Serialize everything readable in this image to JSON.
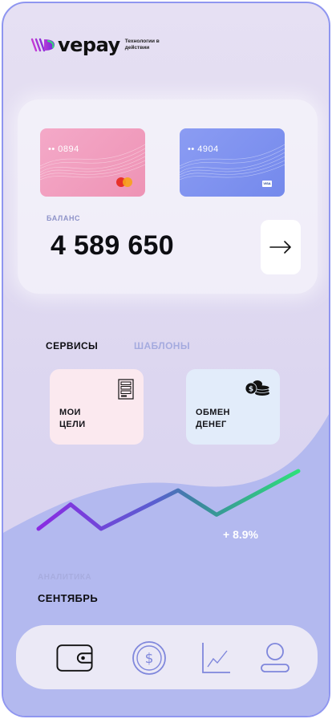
{
  "brand": {
    "name": "vepay",
    "tagline": "Технологии в действии"
  },
  "cards": [
    {
      "masked_number": "•• 0894",
      "network": "mastercard",
      "color": "#f0a0c0"
    },
    {
      "masked_number": "•• 4904",
      "network": "visa",
      "color": "#7f93ef",
      "network_label": "VISA"
    }
  ],
  "balance": {
    "label": "БАЛАНС",
    "value": "4 589 650",
    "go_icon": "arrow-right-icon"
  },
  "tabs": [
    {
      "label": "СЕРВИСЫ",
      "active": true
    },
    {
      "label": "ШАБЛОНЫ",
      "active": false
    }
  ],
  "services": [
    {
      "line1": "МОИ",
      "line2": "ЦЕЛИ",
      "icon": "goals-list-icon",
      "bg": "#fbe9ef"
    },
    {
      "line1": "ОБМЕН",
      "line2": "ДЕНЕГ",
      "icon": "coins-icon",
      "bg": "#e2ecfa"
    }
  ],
  "analytics": {
    "label": "АНАЛИТИКА",
    "month": "СЕНТЯБРЬ",
    "change": "+ 8.9%",
    "trend_points": [
      0,
      0.38,
      0,
      0.6,
      0.22,
      0.9
    ]
  },
  "nav": [
    {
      "icon": "wallet-icon",
      "active": true
    },
    {
      "icon": "dollar-coin-icon",
      "active": false
    },
    {
      "icon": "chart-icon",
      "active": false
    },
    {
      "icon": "profile-icon",
      "active": false
    }
  ],
  "colors": {
    "accent": "#8f96f0",
    "chart_start": "#8a2be2",
    "chart_end": "#2ee07a"
  }
}
